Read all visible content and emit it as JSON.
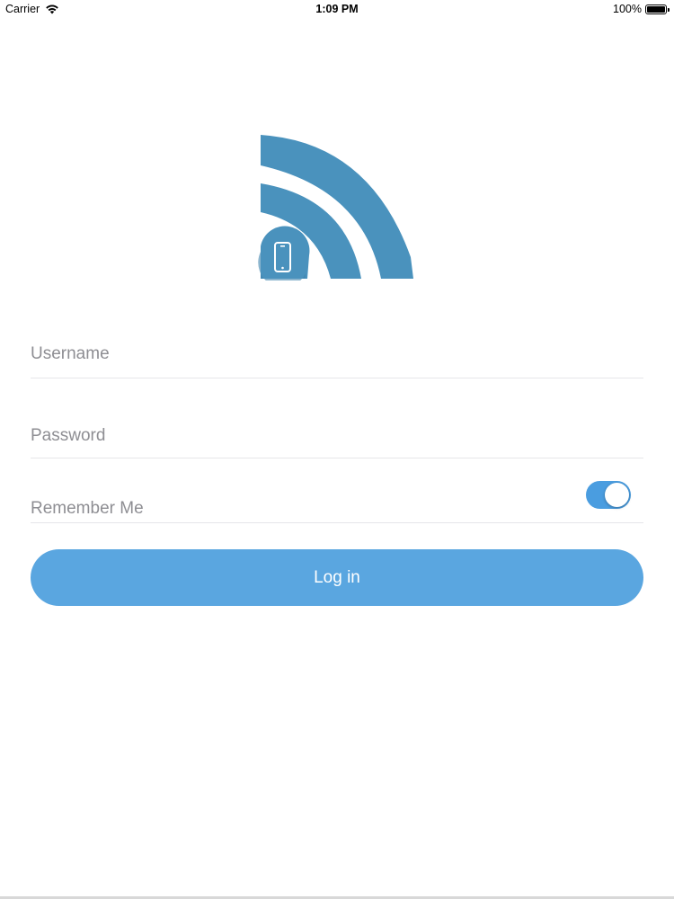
{
  "status_bar": {
    "carrier": "Carrier",
    "wifi_icon": "wifi-icon",
    "time": "1:09 PM",
    "battery_percent": "100%",
    "battery_icon": "battery-icon"
  },
  "logo": {
    "icon": "wifi-phone-logo",
    "color": "#4a92bd"
  },
  "form": {
    "username_placeholder": "Username",
    "username_value": "",
    "password_placeholder": "Password",
    "password_value": "",
    "remember_label": "Remember Me",
    "remember_on": true,
    "login_label": "Log in"
  },
  "colors": {
    "accent": "#5aa6e0",
    "toggle_on": "#4a9de0",
    "placeholder": "#8e8e93",
    "logo_blue": "#4a92bd"
  }
}
